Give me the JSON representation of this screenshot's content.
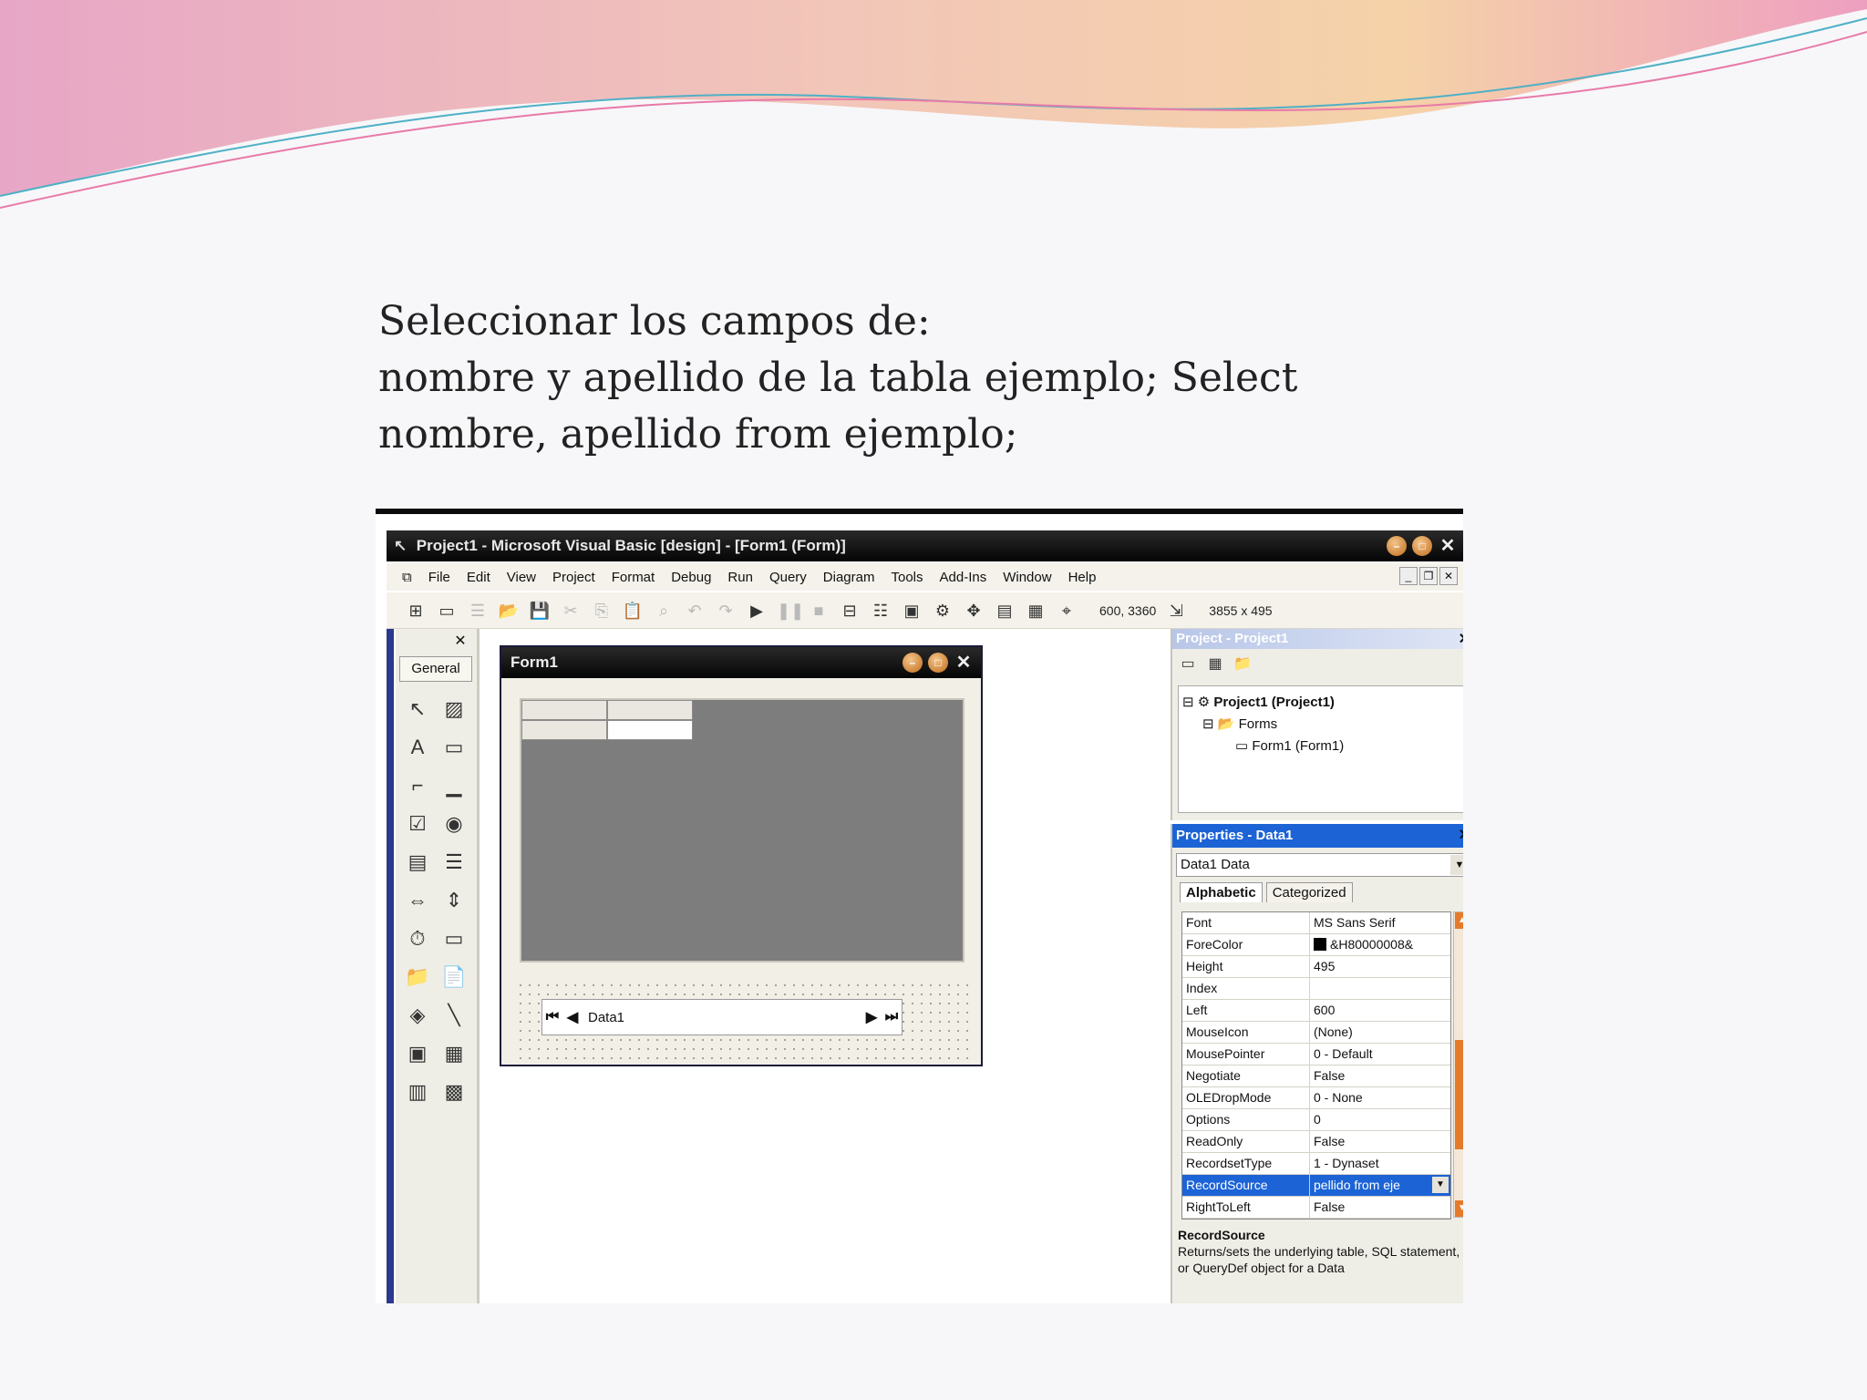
{
  "slide": {
    "lines": [
      "Seleccionar los campos de:",
      "nombre y apellido de la tabla ejemplo; Select",
      "nombre, apellido from ejemplo;"
    ]
  },
  "vb": {
    "title": "Project1 - Microsoft Visual Basic [design] - [Form1 (Form)]",
    "menu": [
      "File",
      "Edit",
      "View",
      "Project",
      "Format",
      "Debug",
      "Run",
      "Query",
      "Diagram",
      "Tools",
      "Add-Ins",
      "Window",
      "Help"
    ],
    "coords": "600, 3360",
    "size": "3855 x 495",
    "toolbox_tab": "General",
    "form_title": "Form1",
    "data_caption": "Data1",
    "project": {
      "title": "Project - Project1",
      "root": "Project1 (Project1)",
      "folder": "Forms",
      "item": "Form1 (Form1)"
    },
    "properties": {
      "title": "Properties - Data1",
      "object": "Data1 Data",
      "tab_alpha": "Alphabetic",
      "tab_cat": "Categorized",
      "rows": [
        {
          "name": "Font",
          "value": "MS Sans Serif"
        },
        {
          "name": "ForeColor",
          "value": "&H80000008&"
        },
        {
          "name": "Height",
          "value": "495"
        },
        {
          "name": "Index",
          "value": ""
        },
        {
          "name": "Left",
          "value": "600"
        },
        {
          "name": "MouseIcon",
          "value": "(None)"
        },
        {
          "name": "MousePointer",
          "value": "0 - Default"
        },
        {
          "name": "Negotiate",
          "value": "False"
        },
        {
          "name": "OLEDropMode",
          "value": "0 - None"
        },
        {
          "name": "Options",
          "value": "0"
        },
        {
          "name": "ReadOnly",
          "value": "False"
        },
        {
          "name": "RecordsetType",
          "value": "1 - Dynaset"
        },
        {
          "name": "RecordSource",
          "value": "pellido from eje"
        },
        {
          "name": "RightToLeft",
          "value": "False"
        }
      ],
      "desc_title": "RecordSource",
      "desc_text": "Returns/sets the underlying table, SQL statement, or QueryDef object for a Data"
    }
  },
  "colors": {
    "title_bar": "#050505",
    "selection": "#1c63d6",
    "grid_bg": "#7d7d7d",
    "panel_bg": "#efeee6"
  }
}
